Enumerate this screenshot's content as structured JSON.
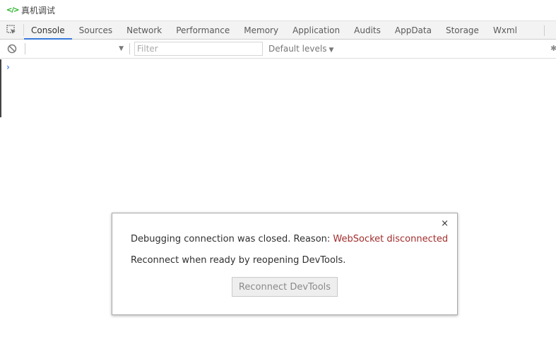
{
  "window": {
    "title": "真机调试",
    "icon": "code-icon"
  },
  "tabs": [
    {
      "label": "Console",
      "active": true
    },
    {
      "label": "Sources"
    },
    {
      "label": "Network"
    },
    {
      "label": "Performance"
    },
    {
      "label": "Memory"
    },
    {
      "label": "Application"
    },
    {
      "label": "Audits"
    },
    {
      "label": "AppData"
    },
    {
      "label": "Storage"
    },
    {
      "label": "Wxml"
    }
  ],
  "toolbar": {
    "filter_placeholder": "Filter",
    "levels_label": "Default levels"
  },
  "console": {
    "prompt": "›"
  },
  "dialog": {
    "message_prefix": "Debugging connection was closed. Reason: ",
    "reason": "WebSocket disconnected",
    "message2": "Reconnect when ready by reopening DevTools.",
    "button_label": "Reconnect DevTools",
    "close_label": "×"
  },
  "colors": {
    "accent": "#3879d9",
    "reason_text": "#a22d2d",
    "code_icon": "#1aad19"
  }
}
